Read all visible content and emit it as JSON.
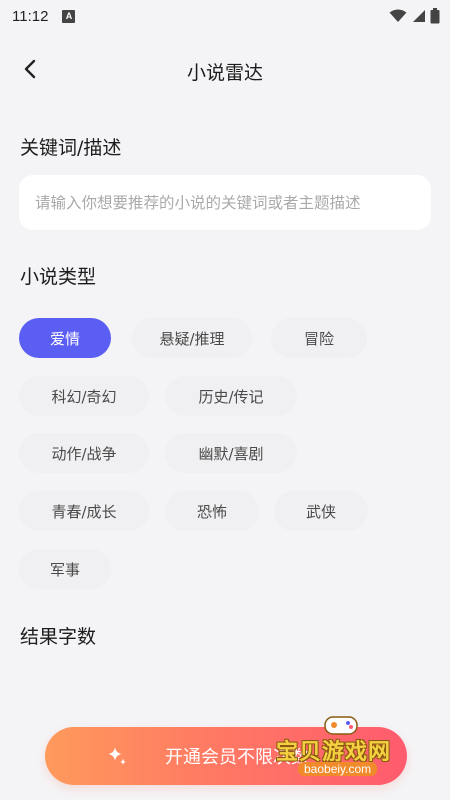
{
  "status_bar": {
    "time": "11:12",
    "notification_letter": "A"
  },
  "header": {
    "title": "小说雷达"
  },
  "keyword_section": {
    "title": "关键词/描述",
    "placeholder": "请输入你想要推荐的小说的关键词或者主题描述"
  },
  "genre_section": {
    "title": "小说类型",
    "selected": "爱情",
    "chips": [
      "爱情",
      "悬疑/推理",
      "冒险",
      "科幻/奇幻",
      "历史/传记",
      "动作/战争",
      "幽默/喜剧",
      "青春/成长",
      "恐怖",
      "武侠",
      "军事"
    ]
  },
  "result_section": {
    "title": "结果字数"
  },
  "cta": {
    "label": "开通会员不限次数"
  },
  "watermark": {
    "text": "宝贝游戏网",
    "url": "baobeiy.com"
  },
  "colors": {
    "accent": "#5b5ef3",
    "cta_start": "#ff9a5c",
    "cta_end": "#ff5b6e",
    "background": "#f4f4f6"
  },
  "icons": {
    "back": "chevron-left-icon",
    "cta": "sparkle-icon"
  }
}
